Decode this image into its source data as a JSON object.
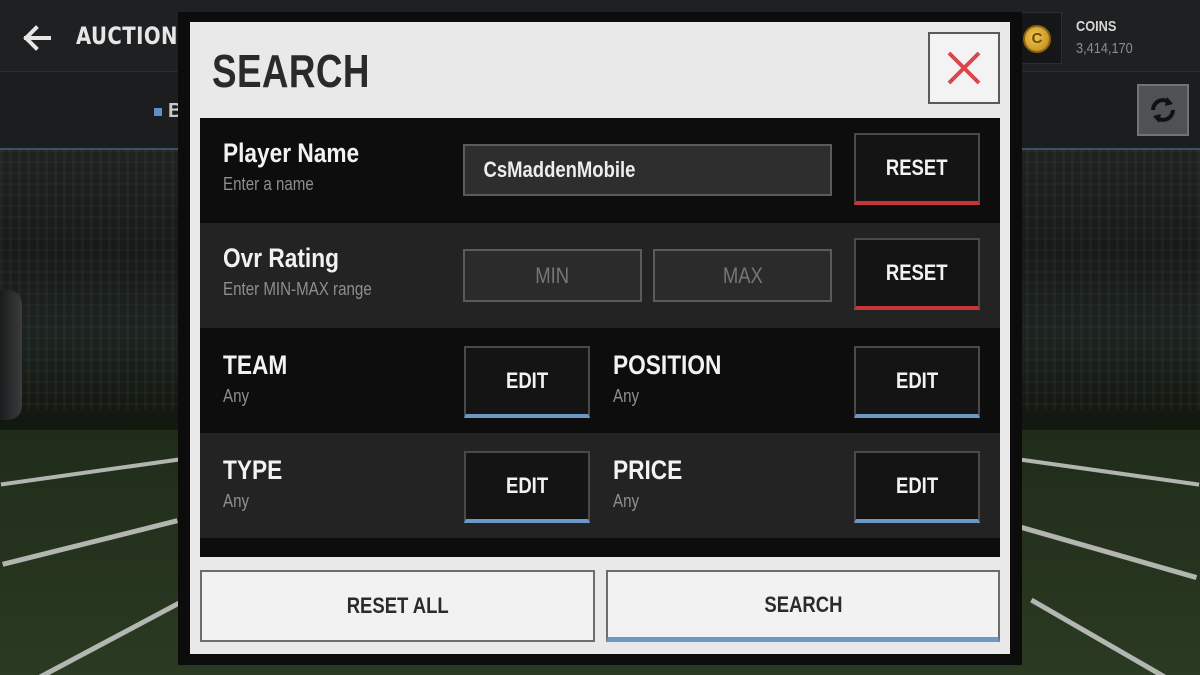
{
  "topbar": {
    "title": "AUCTIONS",
    "coins_label": "COINS",
    "coins_value": "3,414,170",
    "coin_symbol": "C"
  },
  "subbar": {
    "tab_partial": "Br"
  },
  "modal": {
    "title": "SEARCH",
    "player_name": {
      "label": "Player Name",
      "hint": "Enter a name",
      "value": "CsMaddenMobile",
      "reset_label": "RESET"
    },
    "ovr_rating": {
      "label": "Ovr Rating",
      "hint": "Enter MIN-MAX range",
      "min_placeholder": "MIN",
      "max_placeholder": "MAX",
      "reset_label": "RESET"
    },
    "team": {
      "label": "TEAM",
      "value": "Any",
      "edit_label": "EDIT"
    },
    "position": {
      "label": "POSITION",
      "value": "Any",
      "edit_label": "EDIT"
    },
    "type": {
      "label": "TYPE",
      "value": "Any",
      "edit_label": "EDIT"
    },
    "price": {
      "label": "PRICE",
      "value": "Any",
      "edit_label": "EDIT"
    },
    "reset_all_label": "RESET ALL",
    "search_label": "SEARCH"
  },
  "colors": {
    "reset_accent": "#c9333a",
    "edit_accent": "#6b98c8",
    "close_x": "#d9474b"
  },
  "icons": {
    "back": "back-arrow-icon",
    "close": "close-icon",
    "refresh": "refresh-icon",
    "coin": "coin-icon"
  }
}
